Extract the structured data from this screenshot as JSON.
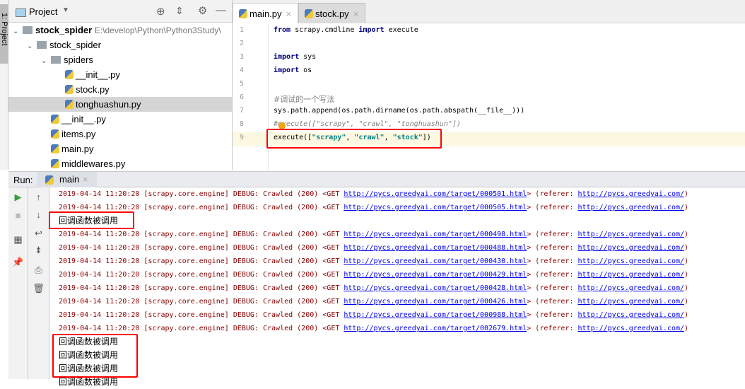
{
  "sidebar_tool": "1: Project",
  "project": {
    "title": "Project",
    "items": [
      {
        "label": "stock_spider",
        "path": "E:\\develop\\Python\\Python3Study\\",
        "kind": "root"
      },
      {
        "label": "stock_spider",
        "kind": "folder"
      },
      {
        "label": "spiders",
        "kind": "folder"
      },
      {
        "label": "__init__.py",
        "kind": "file"
      },
      {
        "label": "stock.py",
        "kind": "file"
      },
      {
        "label": "tonghuashun.py",
        "kind": "file",
        "selected": true
      },
      {
        "label": "__init__.py",
        "kind": "file"
      },
      {
        "label": "items.py",
        "kind": "file"
      },
      {
        "label": "main.py",
        "kind": "file"
      },
      {
        "label": "middlewares.py",
        "kind": "file"
      }
    ]
  },
  "editor": {
    "tabs": [
      {
        "label": "main.py",
        "active": true
      },
      {
        "label": "stock.py",
        "active": false
      }
    ],
    "lines": [
      "1",
      "2",
      "3",
      "4",
      "5",
      "6",
      "7",
      "8",
      "9"
    ],
    "code": {
      "l1a": "from",
      "l1b": " scrapy.cmdline ",
      "l1c": "import",
      "l1d": " execute",
      "l3a": "import",
      "l3b": " sys",
      "l4a": "import",
      "l4b": " os",
      "l6": "#调试的一个写法",
      "l7": "sys.path.append(os.path.dirname(os.path.abspath(__file__)))",
      "l8": "#execute([\"scrapy\", \"crawl\", \"tonghuashun\"])",
      "l9a": "execute([",
      "l9b": "\"scrapy\"",
      "l9c": ", ",
      "l9d": "\"crawl\"",
      "l9e": ", ",
      "l9f": "\"stock\"",
      "l9g": "])"
    }
  },
  "run": {
    "label": "Run:",
    "tab": "main"
  },
  "console": {
    "prefix": "2019-04-14 11:20:20 [scrapy.core.engine] DEBUG: Crawled (200) <GET ",
    "referer_label": "> (referer: ",
    "referer": "http://pycs.greedyai.com/",
    "suffix": ")",
    "callback": "回调函数被调用",
    "rows": [
      {
        "url": "http://pycs.greedyai.com/target/000501.html"
      },
      {
        "url": "http://pycs.greedyai.com/target/000505.html"
      },
      {
        "cb": true
      },
      {
        "url": "http://pycs.greedyai.com/target/000498.html"
      },
      {
        "url": "http://pycs.greedyai.com/target/000488.html"
      },
      {
        "url": "http://pycs.greedyai.com/target/000430.html"
      },
      {
        "url": "http://pycs.greedyai.com/target/000429.html"
      },
      {
        "url": "http://pycs.greedyai.com/target/000428.html"
      },
      {
        "url": "http://pycs.greedyai.com/target/000426.html"
      },
      {
        "url": "http://pycs.greedyai.com/target/000988.html"
      },
      {
        "url": "http://pycs.greedyai.com/target/002679.html"
      },
      {
        "cb": true
      },
      {
        "cb": true
      },
      {
        "cb": true
      },
      {
        "cb": true
      }
    ]
  }
}
